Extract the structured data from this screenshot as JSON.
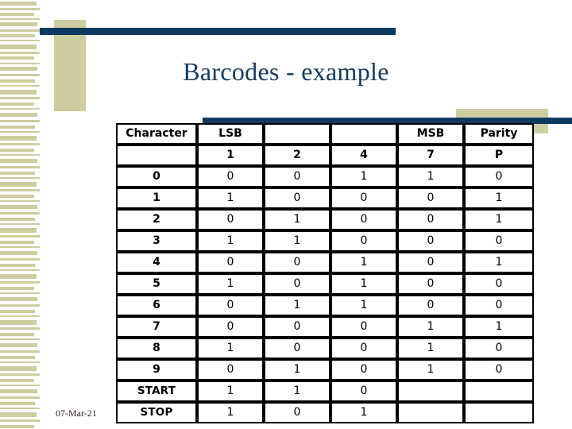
{
  "slide": {
    "title": "Barcodes - example",
    "date": "07-Mar-21"
  },
  "theme": {
    "accent_navy": "#0f3a60",
    "accent_tan": "#cdcd9f",
    "title_color": "#133a5e",
    "background": "#ffffff"
  },
  "table": {
    "headers": [
      "Character",
      "LSB",
      "",
      "",
      "MSB",
      "Parity"
    ],
    "weights": [
      "",
      "1",
      "2",
      "4",
      "7",
      "P"
    ],
    "rows": [
      {
        "character": "0",
        "bits": [
          "0",
          "0",
          "1",
          "1"
        ],
        "parity": "0"
      },
      {
        "character": "1",
        "bits": [
          "1",
          "0",
          "0",
          "0"
        ],
        "parity": "1"
      },
      {
        "character": "2",
        "bits": [
          "0",
          "1",
          "0",
          "0"
        ],
        "parity": "1"
      },
      {
        "character": "3",
        "bits": [
          "1",
          "1",
          "0",
          "0"
        ],
        "parity": "0"
      },
      {
        "character": "4",
        "bits": [
          "0",
          "0",
          "1",
          "0"
        ],
        "parity": "1"
      },
      {
        "character": "5",
        "bits": [
          "1",
          "0",
          "1",
          "0"
        ],
        "parity": "0"
      },
      {
        "character": "6",
        "bits": [
          "0",
          "1",
          "1",
          "0"
        ],
        "parity": "0"
      },
      {
        "character": "7",
        "bits": [
          "0",
          "0",
          "0",
          "1"
        ],
        "parity": "1"
      },
      {
        "character": "8",
        "bits": [
          "1",
          "0",
          "0",
          "1"
        ],
        "parity": "0"
      },
      {
        "character": "9",
        "bits": [
          "0",
          "1",
          "0",
          "1"
        ],
        "parity": "0"
      },
      {
        "character": "START",
        "bits": [
          "1",
          "1",
          "0",
          ""
        ],
        "parity": ""
      },
      {
        "character": "STOP",
        "bits": [
          "1",
          "0",
          "1",
          ""
        ],
        "parity": ""
      }
    ]
  }
}
